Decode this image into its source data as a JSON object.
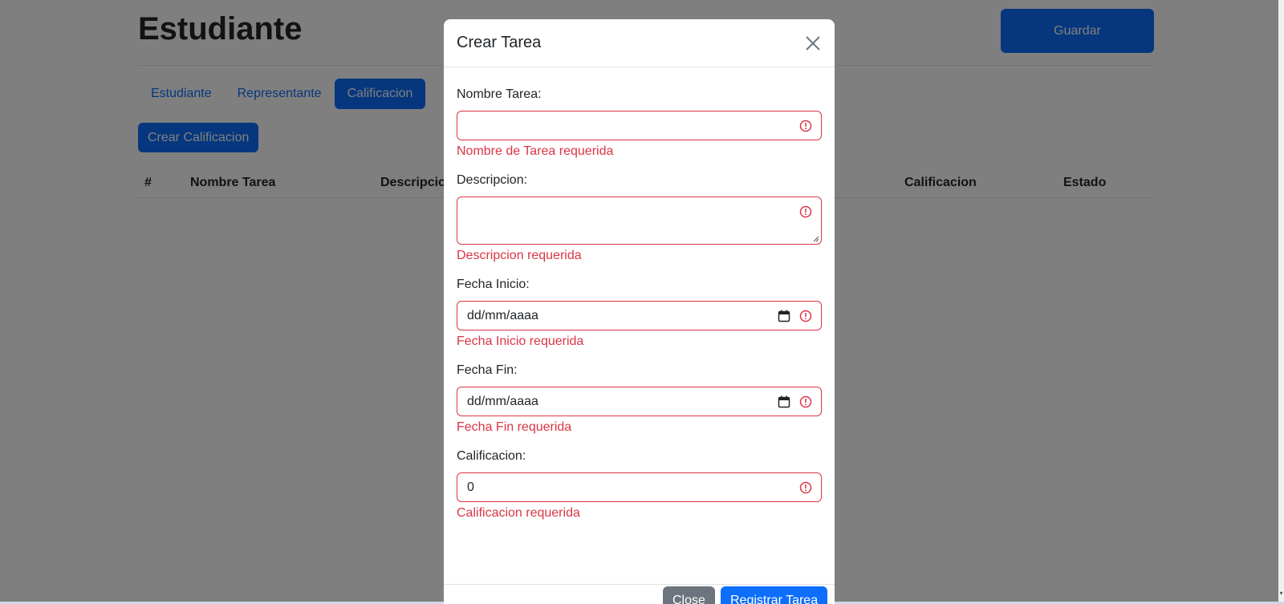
{
  "page": {
    "title": "Estudiante",
    "save_button": "Guardar",
    "tabs": [
      {
        "label": "Estudiante",
        "active": false
      },
      {
        "label": "Representante",
        "active": false
      },
      {
        "label": "Calificacion",
        "active": true
      }
    ],
    "create_grade_button": "Crear Calificacion",
    "table_headers": [
      "#",
      "Nombre Tarea",
      "Descripcion",
      "Calificacion",
      "Estado"
    ]
  },
  "modal": {
    "title": "Crear Tarea",
    "close_icon": "close-icon",
    "fields": [
      {
        "label": "Nombre Tarea:",
        "value": "",
        "error": "Nombre de Tarea requerida"
      },
      {
        "label": "Descripcion:",
        "value": "",
        "error": "Descripcion requerida"
      },
      {
        "label": "Fecha Inicio:",
        "value": "dd/mm/aaaa",
        "error": "Fecha Inicio requerida"
      },
      {
        "label": "Fecha Fin:",
        "value": "dd/mm/aaaa",
        "error": "Fecha Fin requerida"
      },
      {
        "label": "Calificacion:",
        "value": "0",
        "error": "Calificacion requerida"
      }
    ],
    "close_button": "Close",
    "submit_button": "Registrar Tarea"
  },
  "colors": {
    "primary": "#0d6efd",
    "danger": "#dc3545",
    "secondary": "#6c757d",
    "backdrop": "rgba(0,0,0,0.5)"
  }
}
